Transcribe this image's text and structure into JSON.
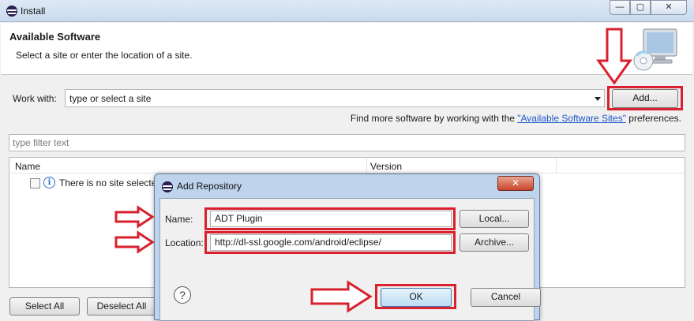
{
  "window": {
    "title": "Install",
    "controls": {
      "minimize": "—",
      "maximize": "▢",
      "close": "✕"
    }
  },
  "header": {
    "title": "Available Software",
    "subtitle": "Select a site or enter the location of a site."
  },
  "work_with": {
    "label": "Work with:",
    "value": "type or select a site",
    "add_button": "Add..."
  },
  "find_more": {
    "prefix": "Find more software by working with the ",
    "link": "\"Available Software Sites\"",
    "suffix": " preferences."
  },
  "filter": {
    "placeholder": "type filter text"
  },
  "table": {
    "columns": [
      "Name",
      "Version"
    ],
    "empty_row": "There is no site selected."
  },
  "buttons": {
    "select_all": "Select All",
    "deselect_all": "Deselect All"
  },
  "dialog": {
    "title": "Add Repository",
    "close": "✕",
    "name_label": "Name:",
    "name_value": "ADT Plugin",
    "location_label": "Location:",
    "location_value": "http://dl-ssl.google.com/android/eclipse/",
    "local_button": "Local...",
    "archive_button": "Archive...",
    "help_glyph": "?",
    "ok_button": "OK",
    "cancel_button": "Cancel"
  },
  "colors": {
    "highlight": "#d8202e",
    "link": "#1d56c9",
    "dialog_frame": "#bed3ec"
  },
  "icons": [
    "eclipse-icon",
    "monitor-cd-icon",
    "info-icon",
    "help-icon",
    "dropdown-arrow-icon",
    "red-arrow-icon"
  ]
}
